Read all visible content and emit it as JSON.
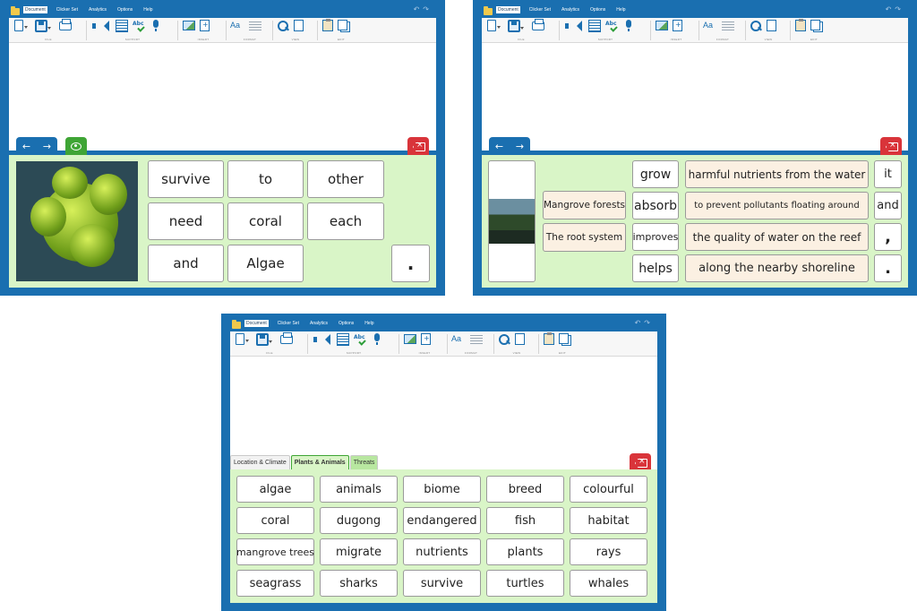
{
  "menu": [
    "Document",
    "Clicker Set",
    "Analytics",
    "Options",
    "Help"
  ],
  "ribbon_groups": [
    "FILE",
    "SUPPORT",
    "INSERT",
    "FORMAT",
    "VIEW",
    "EDIT"
  ],
  "icons": {
    "ribbon": [
      "new-document-icon",
      "save-icon",
      "print-icon",
      "speak-icon",
      "word-list-icon",
      "spellcheck-icon",
      "microphone-icon",
      "picture-icon",
      "insert-icon",
      "font-icon",
      "paragraph-icon",
      "search-icon",
      "view-icon",
      "paste-icon",
      "duplicate-icon"
    ],
    "nav": [
      "arrow-left-icon",
      "arrow-right-icon"
    ],
    "eye": "eye-icon",
    "delete": "backspace-icon",
    "undo": "undo-icon",
    "redo": "redo-icon"
  },
  "colors": {
    "frame": "#1a6fb0",
    "panel": "#d9f5c7",
    "accent_green": "#3fa535",
    "delete_red": "#d9343a",
    "phrase_cell": "#fbf0e2"
  },
  "nav": {
    "back": "←",
    "forward": "→"
  },
  "screen_a": {
    "image_alt": "coral",
    "words": [
      "survive",
      "to",
      "other",
      "need",
      "coral",
      "each",
      "and",
      "Algae"
    ],
    "punctuation": "."
  },
  "screen_b": {
    "image_alt": "mangrove forest",
    "subjects": [
      "Mangrove forests",
      "The root system"
    ],
    "verbs": [
      "grow",
      "absorb",
      "improves",
      "helps"
    ],
    "phrases": [
      "harmful nutrients from the water",
      "to prevent pollutants floating around",
      "the quality of water on the reef",
      "along the nearby shoreline"
    ],
    "right_col": [
      "it",
      "and",
      ",",
      "."
    ]
  },
  "screen_c": {
    "tabs": [
      "Location & Climate",
      "Plants & Animals",
      "Threats"
    ],
    "active_tab": "Plants & Animals",
    "words": [
      "algae",
      "animals",
      "biome",
      "breed",
      "colourful",
      "coral",
      "dugong",
      "endangered",
      "fish",
      "habitat",
      "mangrove trees",
      "migrate",
      "nutrients",
      "plants",
      "rays",
      "seagrass",
      "sharks",
      "survive",
      "turtles",
      "whales"
    ]
  }
}
